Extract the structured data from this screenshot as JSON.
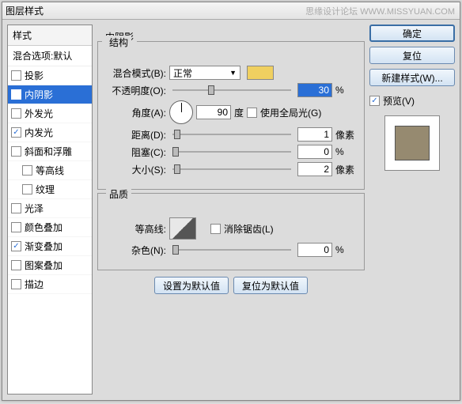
{
  "window": {
    "title": "图层样式",
    "watermark": "思缘设计论坛  WWW.MISSYUAN.COM"
  },
  "styles": {
    "header": "样式",
    "blend": "混合选项:默认",
    "items": [
      {
        "label": "投影",
        "checked": false
      },
      {
        "label": "内阴影",
        "checked": true,
        "selected": true
      },
      {
        "label": "外发光",
        "checked": false
      },
      {
        "label": "内发光",
        "checked": true
      },
      {
        "label": "斜面和浮雕",
        "checked": false
      },
      {
        "label": "等高线",
        "checked": false,
        "sub": true
      },
      {
        "label": "纹理",
        "checked": false,
        "sub": true
      },
      {
        "label": "光泽",
        "checked": false
      },
      {
        "label": "颜色叠加",
        "checked": false
      },
      {
        "label": "渐变叠加",
        "checked": true
      },
      {
        "label": "图案叠加",
        "checked": false
      },
      {
        "label": "描边",
        "checked": false
      }
    ]
  },
  "main": {
    "title": "内阴影",
    "structure": {
      "title": "结构",
      "blend_mode_label": "混合模式(B):",
      "blend_mode_value": "正常",
      "opacity_label": "不透明度(O):",
      "opacity_value": "30",
      "opacity_unit": "%",
      "angle_label": "角度(A):",
      "angle_value": "90",
      "angle_unit": "度",
      "global_light": "使用全局光(G)",
      "distance_label": "距离(D):",
      "distance_value": "1",
      "distance_unit": "像素",
      "choke_label": "阻塞(C):",
      "choke_value": "0",
      "choke_unit": "%",
      "size_label": "大小(S):",
      "size_value": "2",
      "size_unit": "像素"
    },
    "quality": {
      "title": "品质",
      "contour_label": "等高线:",
      "antialias": "消除锯齿(L)",
      "noise_label": "杂色(N):",
      "noise_value": "0",
      "noise_unit": "%"
    },
    "set_default": "设置为默认值",
    "reset_default": "复位为默认值"
  },
  "buttons": {
    "ok": "确定",
    "cancel": "复位",
    "new_style": "新建样式(W)...",
    "preview": "预览(V)"
  }
}
